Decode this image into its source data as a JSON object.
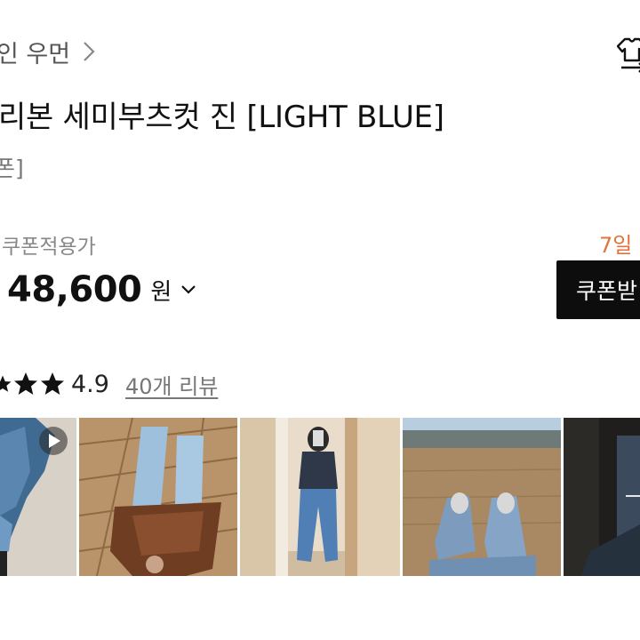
{
  "breadcrumb": {
    "text": "인 우먼"
  },
  "product": {
    "title": "리본 세미부츠컷 진 [LIGHT BLUE]",
    "tag": "폰]"
  },
  "price": {
    "coupon_label": "쿠폰적용가",
    "value": "48,600",
    "unit": "원"
  },
  "delivery": {
    "text": "7일 !"
  },
  "coupon_button": {
    "label": "쿠폰받"
  },
  "rating": {
    "value": "4.9",
    "review_link": "40개 리뷰",
    "visible_stars": 3
  },
  "gallery": {
    "images": [
      "video-thumbnail",
      "photo-brown-leather-skirt",
      "photo-mirror-selfie",
      "photo-field",
      "photo-dark"
    ],
    "has_video": true
  },
  "colors": {
    "delivery_text": "#e2733a",
    "button_bg": "#0d0d0d"
  }
}
